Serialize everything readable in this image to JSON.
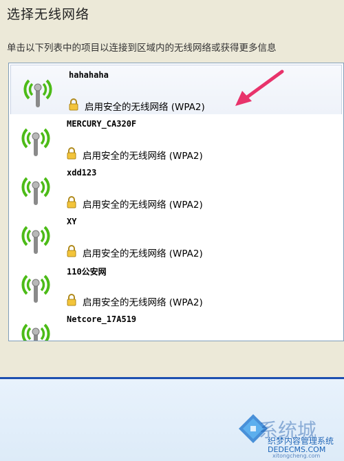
{
  "header": {
    "title": "选择无线网络",
    "description": "单击以下列表中的项目以连接到区域内的无线网络或获得更多信息"
  },
  "networks": [
    {
      "ssid": "hahahaha",
      "security": "启用安全的无线网络 (WPA2)",
      "signal_icon": "wireless-signal-icon",
      "lock_icon": "lock-icon",
      "selected": true
    },
    {
      "ssid": "MERCURY_CA320F",
      "security": "启用安全的无线网络 (WPA2)",
      "signal_icon": "wireless-signal-icon",
      "lock_icon": "lock-icon"
    },
    {
      "ssid": "xdd123",
      "security": "启用安全的无线网络 (WPA2)",
      "signal_icon": "wireless-signal-icon",
      "lock_icon": "lock-icon"
    },
    {
      "ssid": "XY",
      "security": "启用安全的无线网络 (WPA2)",
      "signal_icon": "wireless-signal-icon",
      "lock_icon": "lock-icon"
    },
    {
      "ssid": "110公安网",
      "security": "启用安全的无线网络 (WPA2)",
      "signal_icon": "wireless-signal-icon",
      "lock_icon": "lock-icon"
    },
    {
      "ssid": "Netcore_17A519",
      "security": "",
      "signal_icon": "wireless-signal-icon",
      "lock_icon": ""
    }
  ],
  "annotation": {
    "icon": "red-arrow-icon",
    "color": "#e8336b"
  },
  "watermark": {
    "logo_text": "系统城",
    "line1": "织梦内容管理系统",
    "line2": "DEDECMS.COM",
    "line3": "xitongcheng.com"
  },
  "colors": {
    "signal_green": "#4cbb17",
    "list_border": "#7f9db9",
    "taskbar_blue": "#1c4fb0"
  }
}
